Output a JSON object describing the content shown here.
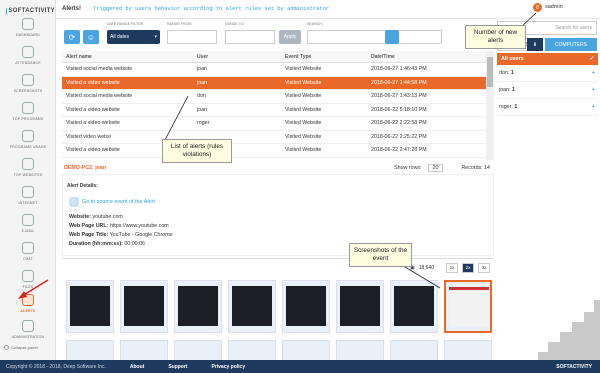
{
  "app": {
    "logo": "SOFTACTIVITY"
  },
  "sidebar": {
    "items": [
      {
        "label": "DASHBOARD"
      },
      {
        "label": "ATTENDANCE"
      },
      {
        "label": "SCREENSHOTS"
      },
      {
        "label": "TOP PROGRAMS"
      },
      {
        "label": "PROGRAMS USAGE"
      },
      {
        "label": "TOP WEBSITES"
      },
      {
        "label": "INTERNET"
      },
      {
        "label": "E-MAIL"
      },
      {
        "label": "CHAT"
      },
      {
        "label": "FILES"
      },
      {
        "label": "ALERTS"
      },
      {
        "label": "ADMINISTRATION"
      }
    ],
    "collapse": "Collapse panel"
  },
  "header": {
    "tab": "Alerts!",
    "subtitle": "Triggered by users behavior according to alert rules set by administrator",
    "badge": "8",
    "user": "sadmin"
  },
  "filters": {
    "date_label": "DATE RANGE FILTER",
    "date_value": "All dates",
    "from_label": "RANGE FROM",
    "to_label": "RANGE TO",
    "apply": "Apply",
    "search_label": "SEARCH:",
    "search_users": "Search for users",
    "users_tab": "USERS",
    "computers_tab": "COMPUTERS"
  },
  "table": {
    "headers": [
      "Alert name",
      "User",
      "Event Type",
      "Date/Time"
    ],
    "rows": [
      [
        "Visited social media website",
        "joan",
        "Visited Website",
        "2018-06-27 1:46:43 PM"
      ],
      [
        "Visited a video website",
        "joan",
        "Visited Website",
        "2018-06-27 1:44:58 PM"
      ],
      [
        "Visited social media website",
        "don",
        "Visited Website",
        "2018-06-27 1:43:13 PM"
      ],
      [
        "Visited a video website",
        "joan",
        "Visited Website",
        "2018-06-22 5:18:10 PM"
      ],
      [
        "Visited a video website",
        "roger",
        "Visited Website",
        "2018-06-22 2:22:58 PM"
      ],
      [
        "Visited video websi",
        "",
        "Visited Website",
        "2018-06-22 2:25:22 PM"
      ],
      [
        "Visited a video website",
        "",
        "Visited Website",
        "2018-06-22 2:47:28 PM"
      ]
    ],
    "selected": 1
  },
  "users_panel": {
    "all": "All users",
    "users": [
      {
        "name": "don:",
        "count": "1"
      },
      {
        "name": "joan:",
        "count": "1"
      },
      {
        "name": "roger:",
        "count": "1"
      }
    ]
  },
  "pager": {
    "computer": "DEMO-PC2: joan",
    "show_rows": "Show rows:",
    "rows_value": "20",
    "records": "Records: 14"
  },
  "details": {
    "title": "Alert Details:",
    "goto": "Go to source event of the Alert",
    "website_label": "Website:",
    "website": "youtube.com",
    "url_label": "Web Page URL:",
    "url": "https://www.youtube.com",
    "page_title_label": "Web Page Title:",
    "page_title": "YouTube - Google Chrome",
    "duration_label": "Duration (hh:mm:ss):",
    "duration": "00:00:06"
  },
  "shots": {
    "count": "18,640",
    "zoom": [
      "1x",
      "2x",
      "3x"
    ]
  },
  "callouts": {
    "new_alerts": "Number of new alerts",
    "list": "List of alerts (rules violations)",
    "screens": "Screenshots of the event"
  },
  "footer": {
    "copyright": "Copyright © 2018 - 2018, Deep Software Inc.",
    "about": "About",
    "support": "Support",
    "privacy": "Privacy policy",
    "logo": "SOFTACTIVITY"
  },
  "colors": {
    "accent": "#e8692a",
    "blue": "#29a3e0",
    "navy": "#1f3a5f"
  }
}
